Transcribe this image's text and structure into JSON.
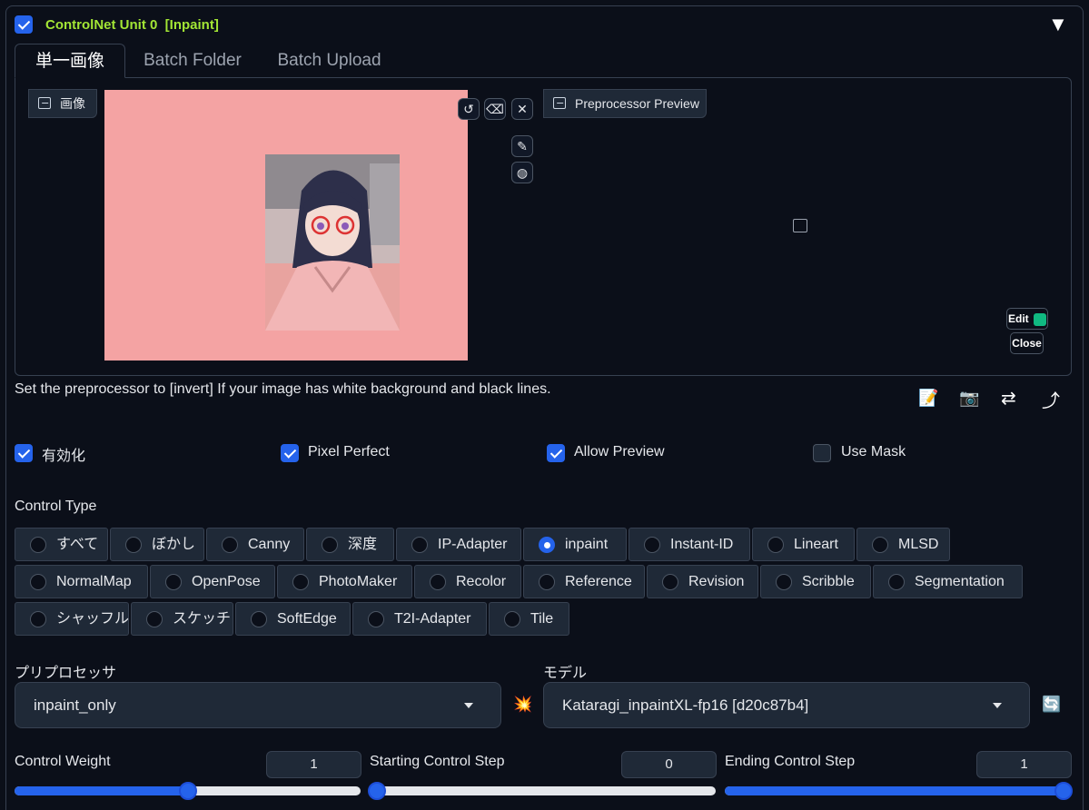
{
  "unit": {
    "title": "ControlNet Unit 0",
    "tag": "[Inpaint]",
    "enabled": true,
    "collapse_glyph": "▼"
  },
  "tabs": [
    "単一画像",
    "Batch Folder",
    "Batch Upload"
  ],
  "image_block": {
    "label": "画像",
    "icon": "image-icon"
  },
  "preview_block": {
    "label": "Preprocessor Preview",
    "icon": "image-icon"
  },
  "image_tools": {
    "undo": "↺",
    "erase": "⌫",
    "close": "✕",
    "brush": "✎",
    "palette": "◍"
  },
  "preview_buttons": {
    "edit": "Edit",
    "close": "Close"
  },
  "hint_text": "Set the preprocessor to [invert] If your image has white background and black lines.",
  "action_icons": [
    "📝",
    "📷",
    "⇄",
    "⤴"
  ],
  "options": [
    {
      "label": "有効化",
      "checked": true
    },
    {
      "label": "Pixel Perfect",
      "checked": true
    },
    {
      "label": "Allow Preview",
      "checked": true
    },
    {
      "label": "Use Mask",
      "checked": false
    }
  ],
  "control_type": {
    "label": "Control Type",
    "selected": "inpaint",
    "items": [
      "すべて",
      "ぼかし",
      "Canny",
      "深度",
      "IP-Adapter",
      "inpaint",
      "Instant-ID",
      "Lineart",
      "MLSD",
      "NormalMap",
      "OpenPose",
      "PhotoMaker",
      "Recolor",
      "Reference",
      "Revision",
      "Scribble",
      "Segmentation",
      "シャッフル",
      "スケッチ",
      "SoftEdge",
      "T2I-Adapter",
      "Tile"
    ]
  },
  "preprocessor": {
    "label": "プリプロセッサ",
    "value": "inpaint_only",
    "run_icon": "💥"
  },
  "model": {
    "label": "モデル",
    "value": "Kataragi_inpaintXL-fp16 [d20c87b4]",
    "refresh_icon": "🔄"
  },
  "sliders": [
    {
      "label": "Control Weight",
      "value": "1",
      "min": 0,
      "max": 2,
      "num": 1
    },
    {
      "label": "Starting Control Step",
      "value": "0",
      "min": 0,
      "max": 1,
      "num": 0
    },
    {
      "label": "Ending Control Step",
      "value": "1",
      "min": 0,
      "max": 1,
      "num": 1
    }
  ],
  "colors": {
    "accent": "#2563eb",
    "unit_title": "#a3e635",
    "mask_bg": "#f4a3a3"
  }
}
